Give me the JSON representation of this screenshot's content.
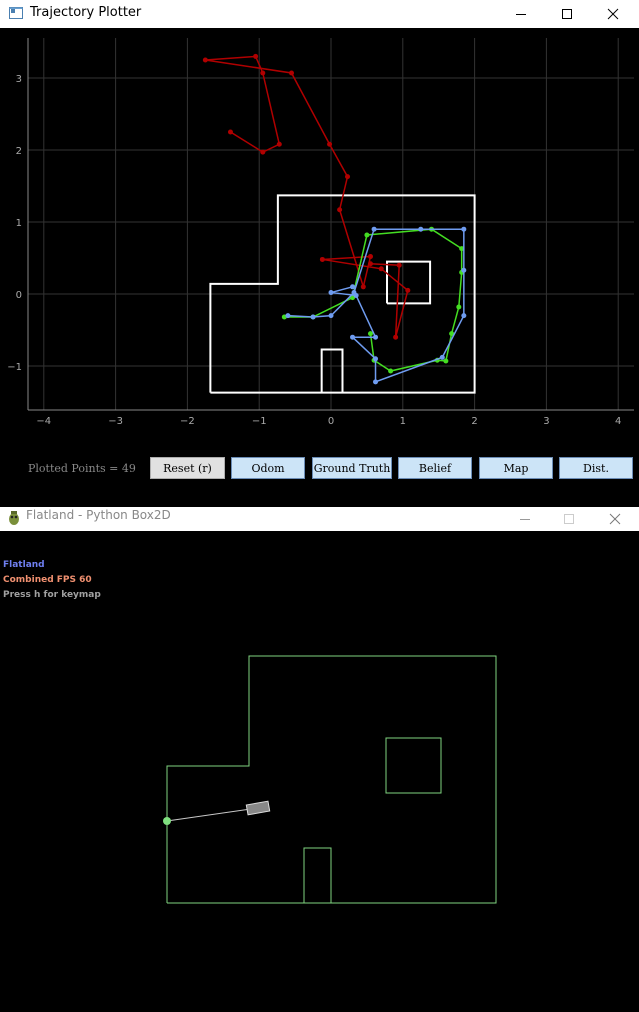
{
  "plotter": {
    "title": "Trajectory Plotter",
    "x_ticks": [
      "−4",
      "−3",
      "−2",
      "−1",
      "0",
      "1",
      "2",
      "3",
      "4"
    ],
    "y_ticks": [
      "3",
      "2",
      "1",
      "0",
      "−1"
    ],
    "plotted_points": "Plotted Points = 49",
    "buttons": {
      "reset": "Reset (r)",
      "odom": "Odom",
      "ground_truth": "Ground Truth",
      "belief": "Belief",
      "map": "Map",
      "dist": "Dist."
    }
  },
  "chart_data": {
    "type": "line",
    "xlim": [
      -4.2,
      4.2
    ],
    "ylim": [
      -1.65,
      3.5
    ],
    "grid": true,
    "series": [
      {
        "color": "#b00000",
        "values": [
          [
            -1.4,
            2.25
          ],
          [
            -0.95,
            1.97
          ],
          [
            -0.72,
            2.08
          ],
          [
            -0.95,
            3.07
          ],
          [
            -1.05,
            3.3
          ],
          [
            -1.75,
            3.25
          ],
          [
            -0.55,
            3.07
          ],
          [
            -0.02,
            2.08
          ],
          [
            0.23,
            1.63
          ],
          [
            0.12,
            1.17
          ],
          [
            0.45,
            0.1
          ],
          [
            0.55,
            0.52
          ],
          [
            -0.12,
            0.48
          ],
          [
            0.7,
            0.35
          ],
          [
            1.07,
            0.05
          ],
          [
            0.9,
            -0.6
          ],
          [
            0.95,
            0.4
          ],
          [
            0.55,
            0.42
          ]
        ]
      },
      {
        "color": "#44dd22",
        "values": [
          [
            -0.65,
            -0.32
          ],
          [
            -0.25,
            -0.32
          ],
          [
            0.3,
            -0.05
          ],
          [
            0.5,
            0.82
          ],
          [
            1.4,
            0.9
          ],
          [
            1.82,
            0.63
          ],
          [
            1.82,
            0.3
          ],
          [
            1.78,
            -0.18
          ],
          [
            1.68,
            -0.55
          ],
          [
            1.6,
            -0.93
          ],
          [
            1.48,
            -0.92
          ],
          [
            0.83,
            -1.07
          ],
          [
            0.6,
            -0.92
          ],
          [
            0.55,
            -0.55
          ]
        ]
      },
      {
        "color": "#6f9cf0",
        "values": [
          [
            -0.6,
            -0.3
          ],
          [
            -0.25,
            -0.32
          ],
          [
            0,
            -0.3
          ],
          [
            0.32,
            0.02
          ],
          [
            0.6,
            0.9
          ],
          [
            1.25,
            0.9
          ],
          [
            1.85,
            0.9
          ],
          [
            1.85,
            0.33
          ],
          [
            1.85,
            -0.3
          ],
          [
            1.55,
            -0.88
          ],
          [
            0.62,
            -1.22
          ],
          [
            0.62,
            -0.9
          ],
          [
            0.3,
            -0.6
          ],
          [
            0.62,
            -0.6
          ],
          [
            0.35,
            -0.02
          ],
          [
            0,
            0.02
          ],
          [
            0.3,
            0.1
          ]
        ]
      }
    ],
    "walls": [
      [
        -1.68,
        -1.37
      ],
      [
        -1.68,
        0.14
      ],
      [
        -0.74,
        0.14
      ],
      [
        -0.74,
        1.37
      ],
      [
        2.0,
        1.37
      ],
      [
        2.0,
        -1.37
      ],
      [
        -1.68,
        -1.37
      ]
    ],
    "obstacles": [
      [
        [
          0.78,
          -0.13
        ],
        [
          1.38,
          -0.13
        ],
        [
          1.38,
          0.45
        ],
        [
          0.78,
          0.45
        ],
        [
          0.78,
          -0.13
        ]
      ],
      [
        [
          -0.13,
          -1.37
        ],
        [
          -0.13,
          -0.77
        ],
        [
          0.16,
          -0.77
        ],
        [
          0.16,
          -1.37
        ]
      ]
    ]
  },
  "flatland": {
    "title": "Flatland - Python Box2D",
    "label": "Flatland",
    "fps": "Combined FPS 60",
    "hint": "Press h for keymap",
    "colors": {
      "label": "#6f7ff0",
      "fps": "#f09070",
      "hint": "#a0a0a0",
      "walls": "#7fd57f"
    }
  }
}
